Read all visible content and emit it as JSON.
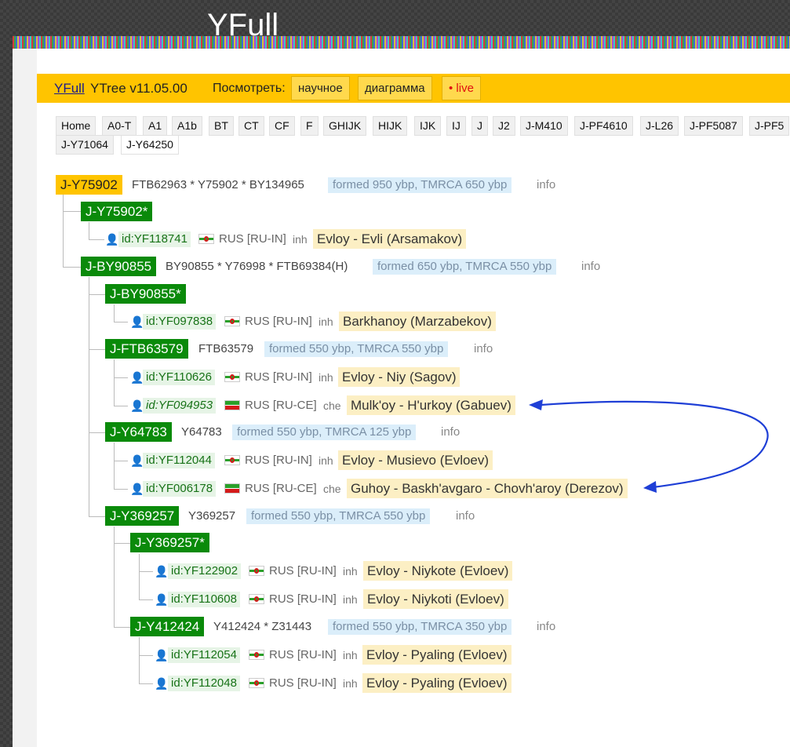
{
  "logo": "YFull",
  "topbar": {
    "brand": "YFull",
    "version": "YTree v11.05.00",
    "view_label": "Посмотреть:",
    "buttons": [
      "научное",
      "диаграмма",
      "• live"
    ]
  },
  "tabs": [
    "Home",
    "A0-T",
    "A1",
    "A1b",
    "BT",
    "CT",
    "CF",
    "F",
    "GHIJK",
    "HIJK",
    "IJK",
    "IJ",
    "J",
    "J2",
    "J-M410",
    "J-PF4610",
    "J-L26",
    "J-PF5087",
    "J-PF5",
    "J-Y71064",
    "J-Y64250"
  ],
  "tree": {
    "root": {
      "name": "J-Y75902",
      "snps": "FTB62963 * Y75902 * BY134965",
      "formed": "formed 950 ybp, TMRCA 650 ybp",
      "info": "info"
    },
    "nodes": [
      {
        "name": "J-Y75902*"
      },
      {
        "name": "J-BY90855",
        "snps": "BY90855 * Y76998 * FTB69384(H)",
        "formed": "formed 650 ybp, TMRCA 550 ybp",
        "info": "info"
      },
      {
        "name": "J-BY90855*"
      },
      {
        "name": "J-FTB63579",
        "snps": "FTB63579",
        "formed": "formed 550 ybp, TMRCA 550 ybp",
        "info": "info"
      },
      {
        "name": "J-Y64783",
        "snps": "Y64783",
        "formed": "formed 550 ybp, TMRCA 125 ybp",
        "info": "info"
      },
      {
        "name": "J-Y369257",
        "snps": "Y369257",
        "formed": "formed 550 ybp, TMRCA 550 ybp",
        "info": "info"
      },
      {
        "name": "J-Y369257*"
      },
      {
        "name": "J-Y412424",
        "snps": "Y412424 * Z31443",
        "formed": "formed 550 ybp, TMRCA 350 ybp",
        "info": "info"
      }
    ],
    "samples": [
      {
        "id": "id:YF118741",
        "flag": "ingushetia",
        "country": "RUS [RU-IN]",
        "lang": "inh",
        "family": "Evloy - Evli (Arsamakov)"
      },
      {
        "id": "id:YF097838",
        "flag": "ingushetia",
        "country": "RUS [RU-IN]",
        "lang": "inh",
        "family": "Barkhanoy (Marzabekov)"
      },
      {
        "id": "id:YF110626",
        "flag": "ingushetia",
        "country": "RUS [RU-IN]",
        "lang": "inh",
        "family": "Evloy - Niy (Sagov)"
      },
      {
        "id": "id:YF094953",
        "flag": "chechnya",
        "country": "RUS [RU-CE]",
        "lang": "che",
        "family": "Mulk'oy - H'urkoy (Gabuev)"
      },
      {
        "id": "id:YF112044",
        "flag": "ingushetia",
        "country": "RUS [RU-IN]",
        "lang": "inh",
        "family": "Evloy - Musievo (Evloev)"
      },
      {
        "id": "id:YF006178",
        "flag": "chechnya",
        "country": "RUS [RU-CE]",
        "lang": "che",
        "family": "Guhoy - Baskh'avgaro - Chovh'aroy (Derezov)"
      },
      {
        "id": "id:YF122902",
        "flag": "ingushetia",
        "country": "RUS [RU-IN]",
        "lang": "inh",
        "family": "Evloy - Niykote (Evloev)"
      },
      {
        "id": "id:YF110608",
        "flag": "ingushetia",
        "country": "RUS [RU-IN]",
        "lang": "inh",
        "family": "Evloy - Niykoti (Evloev)"
      },
      {
        "id": "id:YF112054",
        "flag": "ingushetia",
        "country": "RUS [RU-IN]",
        "lang": "inh",
        "family": "Evloy - Pyaling (Evloev)"
      },
      {
        "id": "id:YF112048",
        "flag": "ingushetia",
        "country": "RUS [RU-IN]",
        "lang": "inh",
        "family": "Evloy - Pyaling (Evloev)"
      }
    ]
  },
  "annotation": {
    "arrow_color": "#1f3fd6"
  },
  "colors": {
    "accent": "#ffc400",
    "node": "#0a8a0a",
    "sample_bg": "#e6f4e6",
    "family_bg": "#fcefc4",
    "formed_bg": "#dbeefa"
  }
}
